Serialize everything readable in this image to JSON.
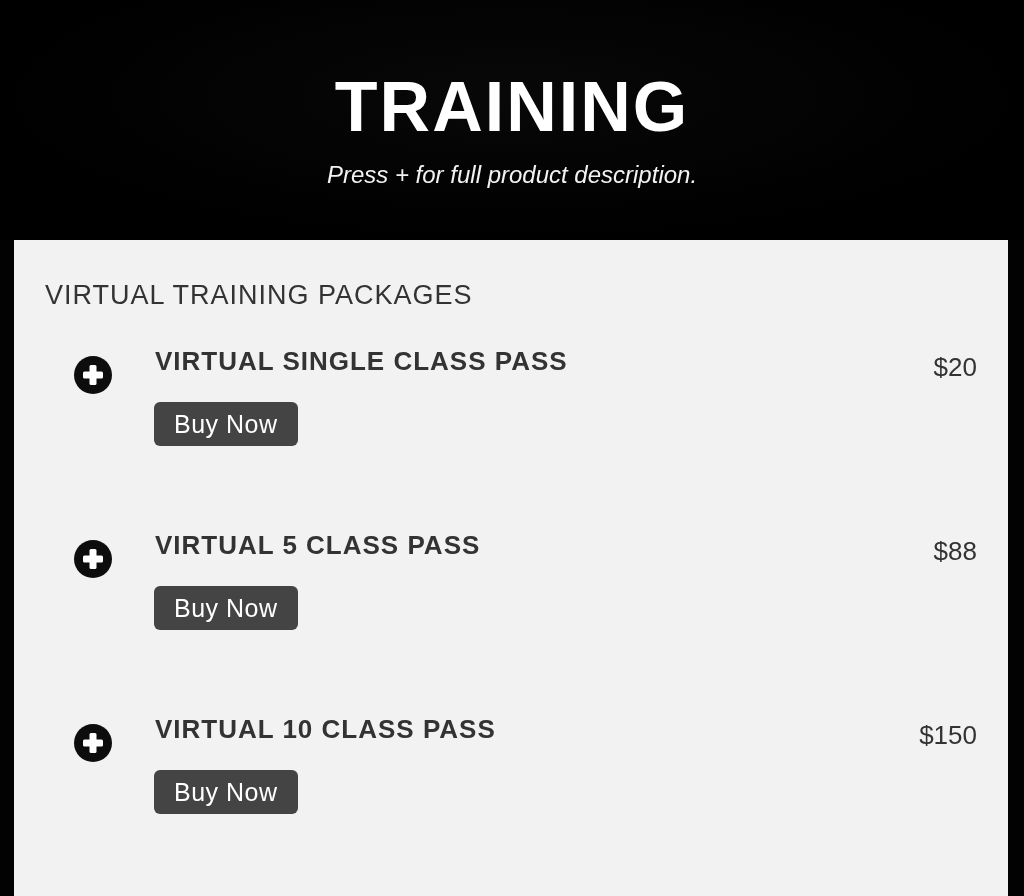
{
  "header": {
    "title": "TRAINING",
    "subtitle": "Press + for full product description."
  },
  "section": {
    "heading": "VIRTUAL TRAINING PACKAGES",
    "products": [
      {
        "name": "VIRTUAL SINGLE CLASS PASS",
        "price": "$20",
        "button": "Buy Now",
        "expanded": false
      },
      {
        "name": "VIRTUAL 5 CLASS PASS",
        "price": "$88",
        "button": "Buy Now",
        "expanded": false
      },
      {
        "name": "VIRTUAL 10 CLASS PASS",
        "price": "$150",
        "button": "Buy Now",
        "expanded": false
      }
    ]
  }
}
